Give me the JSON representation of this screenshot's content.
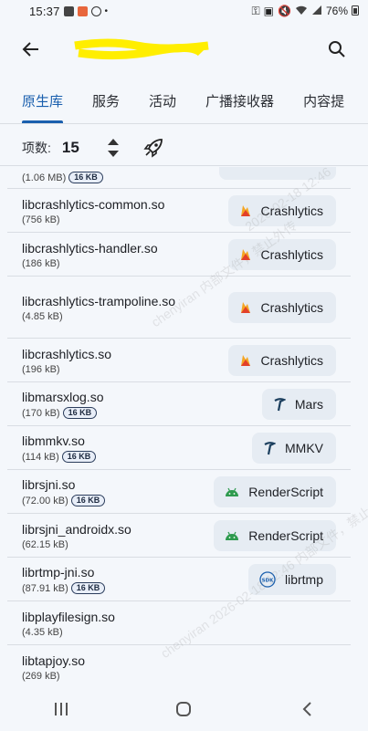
{
  "status_bar": {
    "time": "15:37",
    "battery": "76%"
  },
  "app_bar": {
    "title": ""
  },
  "tabs": [
    {
      "label": "原生库",
      "active": true
    },
    {
      "label": "服务",
      "active": false
    },
    {
      "label": "活动",
      "active": false
    },
    {
      "label": "广播接收器",
      "active": false
    },
    {
      "label": "内容提",
      "active": false
    }
  ],
  "count_row": {
    "label": "项数:",
    "value": "15"
  },
  "partial_row": {
    "size": "(1.06 MB)",
    "badge": "16 KB"
  },
  "libraries": [
    {
      "name": "libcrashlytics-common.so",
      "size": "(756 kB)",
      "badge": "",
      "chip_label": "Crashlytics",
      "chip_icon": "firebase-icon"
    },
    {
      "name": "libcrashlytics-handler.so",
      "size": "(186 kB)",
      "badge": "",
      "chip_label": "Crashlytics",
      "chip_icon": "firebase-icon"
    },
    {
      "name": "libcrashlytics-trampoline.so",
      "size": "(4.85 kB)",
      "badge": "",
      "chip_label": "Crashlytics",
      "chip_icon": "firebase-icon"
    },
    {
      "name": "libcrashlytics.so",
      "size": "(196 kB)",
      "badge": "",
      "chip_label": "Crashlytics",
      "chip_icon": "firebase-icon"
    },
    {
      "name": "libmarsxlog.so",
      "size": "(170 kB)",
      "badge": "16 KB",
      "chip_label": "Mars",
      "chip_icon": "tencent-icon"
    },
    {
      "name": "libmmkv.so",
      "size": "(114 kB)",
      "badge": "16 KB",
      "chip_label": "MMKV",
      "chip_icon": "tencent-icon"
    },
    {
      "name": "librsjni.so",
      "size": "(72.00 kB)",
      "badge": "16 KB",
      "chip_label": "RenderScript",
      "chip_icon": "android-icon"
    },
    {
      "name": "librsjni_androidx.so",
      "size": "(62.15 kB)",
      "badge": "",
      "chip_label": "RenderScript",
      "chip_icon": "android-icon"
    },
    {
      "name": "librtmp-jni.so",
      "size": "(87.91 kB)",
      "badge": "16 KB",
      "chip_label": "librtmp",
      "chip_icon": "sdk-icon"
    },
    {
      "name": "libplayfilesign.so",
      "size": "(4.35 kB)",
      "badge": "",
      "chip_label": "",
      "chip_icon": ""
    },
    {
      "name": "libtapjoy.so",
      "size": "(269 kB)",
      "badge": "",
      "chip_label": "",
      "chip_icon": ""
    }
  ],
  "nav": {
    "recents_icon": "recents-icon",
    "home_icon": "home-icon",
    "back_icon": "back-icon"
  }
}
